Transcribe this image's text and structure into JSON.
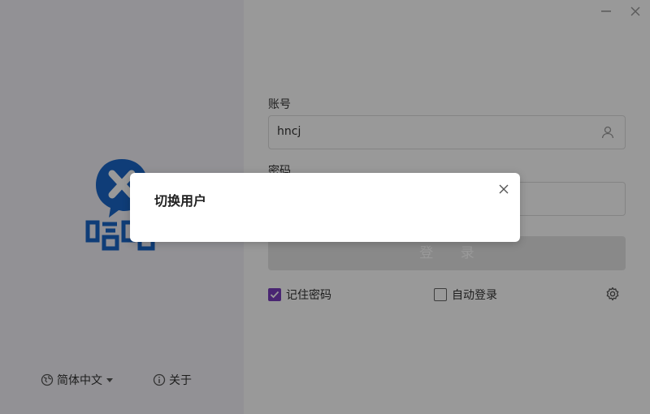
{
  "window": {
    "minimize_icon": "minimize-icon",
    "close_icon": "close-icon"
  },
  "brand": {
    "logo_text": "喧喧",
    "colors": {
      "blue": "#1a66c8",
      "accent": "#7b3fbf"
    }
  },
  "footer": {
    "language_label": "简体中文",
    "about_label": "关于"
  },
  "form": {
    "account_label": "账号",
    "account_value": "hncj",
    "password_label": "密码",
    "login_label": "登 录",
    "remember_label": "记住密码",
    "remember_checked": true,
    "auto_login_label": "自动登录",
    "auto_login_checked": false
  },
  "dialog": {
    "title": "切换用户"
  }
}
